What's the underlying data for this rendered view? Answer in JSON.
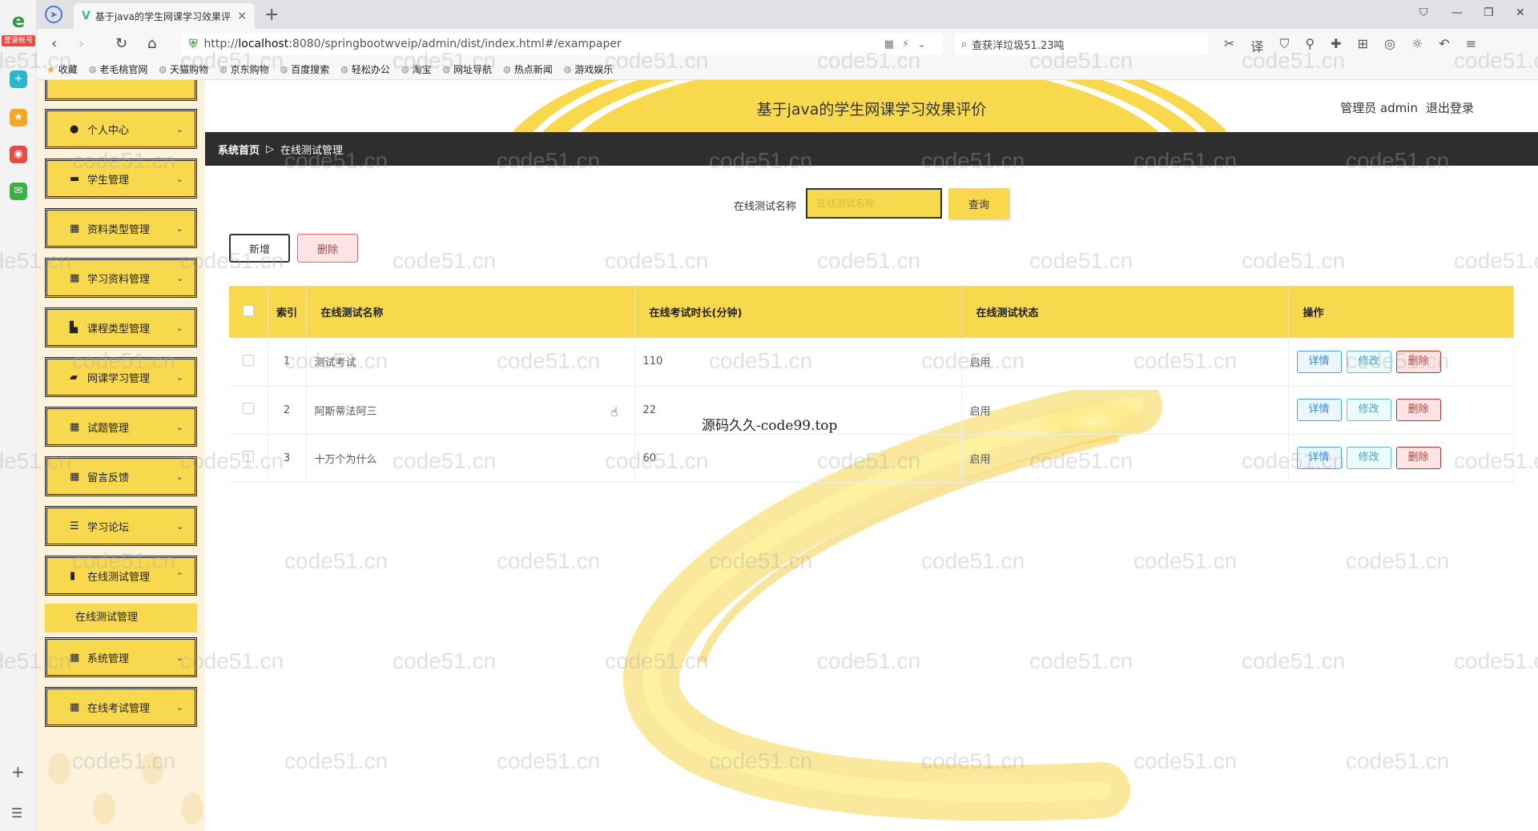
{
  "browser": {
    "tab_title": "基于java的学生网课学习效果评",
    "tab_close": "×",
    "new_tab": "+",
    "url_prefix": "http://",
    "url_host": "localhost",
    "url_rest": ":8080/springbootwveip/admin/dist/index.html#/exampaper",
    "search_text": "查获洋垃圾51.23吨",
    "badge": "登录帐号",
    "bookmarks": [
      "收藏",
      "老毛桃官网",
      "天猫购物",
      "京东购物",
      "百度搜索",
      "轻松办公",
      "淘宝",
      "网址导航",
      "热点新闻",
      "游戏娱乐"
    ]
  },
  "app": {
    "title": "基于java的学生网课学习效果评价",
    "user_label": "管理员 admin",
    "logout": "退出登录"
  },
  "breadcrumb": {
    "home": "系统首页",
    "sep": "▷",
    "current": "在线测试管理"
  },
  "sidebar": {
    "items": [
      {
        "label": "个人中心",
        "icon": "person-icon"
      },
      {
        "label": "学生管理",
        "icon": "card-icon"
      },
      {
        "label": "资料类型管理",
        "icon": "grid-icon"
      },
      {
        "label": "学习资料管理",
        "icon": "grid-icon"
      },
      {
        "label": "课程类型管理",
        "icon": "folder-icon"
      },
      {
        "label": "网课学习管理",
        "icon": "briefcase-icon"
      },
      {
        "label": "试题管理",
        "icon": "grid-icon"
      },
      {
        "label": "留言反馈",
        "icon": "grid-icon"
      },
      {
        "label": "学习论坛",
        "icon": "sliders-icon"
      },
      {
        "label": "在线测试管理",
        "icon": "bar-chart-icon"
      },
      {
        "label": "系统管理",
        "icon": "grid-icon"
      },
      {
        "label": "在线考试管理",
        "icon": "grid-icon"
      }
    ],
    "submenu_label": "在线测试管理"
  },
  "search": {
    "label": "在线测试名称",
    "placeholder": "在线测试名称",
    "query_button": "查询"
  },
  "actions": {
    "add": "新增",
    "delete": "删除"
  },
  "table": {
    "headers": {
      "index": "索引",
      "name": "在线测试名称",
      "duration": "在线考试时长(分钟)",
      "status": "在线测试状态",
      "ops": "操作"
    },
    "rows": [
      {
        "index": "1",
        "name": "测试考试",
        "duration": "110",
        "status": "启用"
      },
      {
        "index": "2",
        "name": "阿斯蒂法阿三",
        "duration": "22",
        "status": "启用"
      },
      {
        "index": "3",
        "name": "十万个为什么",
        "duration": "60",
        "status": "启用"
      }
    ],
    "op_detail": "详情",
    "op_edit": "修改",
    "op_delete": "删除"
  },
  "overlay_text": "源码久久-code99.top",
  "watermark": "code51.cn",
  "colors": {
    "accent_yellow": "#f8d94d",
    "breadcrumb_bg": "#2e2e2e",
    "sidebar_bg": "#fdf3dc"
  }
}
